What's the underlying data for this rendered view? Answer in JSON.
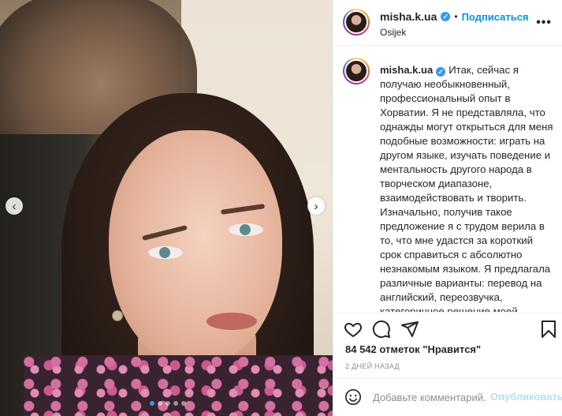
{
  "post": {
    "username": "misha.k.ua",
    "separator": "•",
    "follow_label": "Подписаться",
    "location": "Osijek",
    "more_label": "•••",
    "verified_mark": "✓"
  },
  "caption": {
    "username": "misha.k.ua",
    "text": "Итак, сейчас я получаю необыкновенный, профессиональный опыт в Хорватии. Я не представляла, что однажды могут открыться для меня подобные возможности: играть на другом языке, изучать поведение и ментальность другого народа в творческом диапазоне, взаимодействовать и творить. Изначально, получив такое предложение я с трудом верила в то, что мне удастся за короткий срок справиться с абсолютно незнакомым языком. Я предлагала различные варианты: перевод на английский, переозвучка, категоричное решение моей героини говорить на украинском (мол пусть другие учат)... но"
  },
  "carousel": {
    "prev_icon": "‹",
    "next_icon": "›",
    "slide_count": 5,
    "active_index": 0
  },
  "actions": {
    "like_icon": "heart-icon",
    "comment_icon": "comment-icon",
    "share_icon": "paper-plane-icon",
    "save_icon": "bookmark-icon"
  },
  "likes": "84 542 отметок \"Нравится\"",
  "date": "2 ДНЕЙ НАЗАД",
  "comment": {
    "placeholder": "Добавьте комментарий...",
    "publish_label": "Опубликовать"
  },
  "colors": {
    "accent": "#0095f6",
    "verified": "#3897f0",
    "publish_disabled": "#b2dffc",
    "muted": "#8e8e8e"
  }
}
